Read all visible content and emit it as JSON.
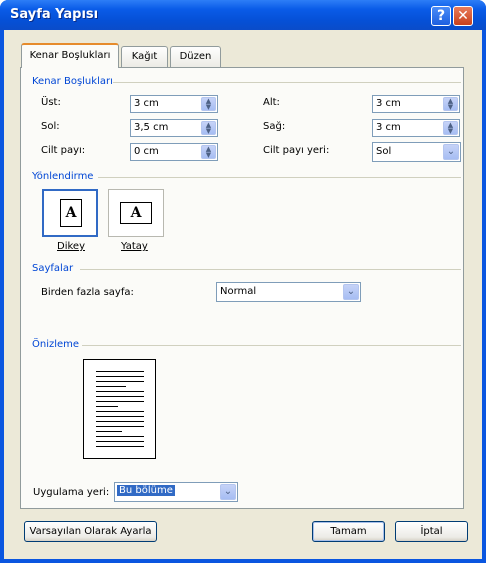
{
  "window": {
    "title": "Sayfa Yapısı",
    "help_glyph": "?",
    "close_glyph": "✕"
  },
  "tabs": [
    {
      "label": "Kenar Boşlukları",
      "active": true
    },
    {
      "label": "Kağıt",
      "active": false
    },
    {
      "label": "Düzen",
      "active": false
    }
  ],
  "margins": {
    "group_label": "Kenar Boşlukları",
    "top_label": "Üst:",
    "top_value": "3 cm",
    "bottom_label": "Alt:",
    "bottom_value": "3 cm",
    "left_label": "Sol:",
    "left_value": "3,5 cm",
    "right_label": "Sağ:",
    "right_value": "3 cm",
    "gutter_label": "Cilt payı:",
    "gutter_value": "0 cm",
    "gutter_pos_label": "Cilt payı yeri:",
    "gutter_pos_value": "Sol"
  },
  "orientation": {
    "group_label": "Yönlendirme",
    "portrait_label": "Dikey",
    "landscape_label": "Yatay",
    "icon_letter": "A",
    "selected": "portrait"
  },
  "pages": {
    "group_label": "Sayfalar",
    "multiple_label": "Birden fazla sayfa:",
    "multiple_value": "Normal"
  },
  "preview": {
    "group_label": "Önizleme"
  },
  "apply": {
    "label": "Uygulama yeri:",
    "value": "Bu bölüme"
  },
  "buttons": {
    "default": "Varsayılan Olarak Ayarla",
    "ok": "Tamam",
    "cancel": "İptal"
  },
  "colors": {
    "group_label": "#0046d5",
    "title_bar": "#0a5ce8",
    "close_button": "#c8401c",
    "selection": "#316ac5"
  }
}
